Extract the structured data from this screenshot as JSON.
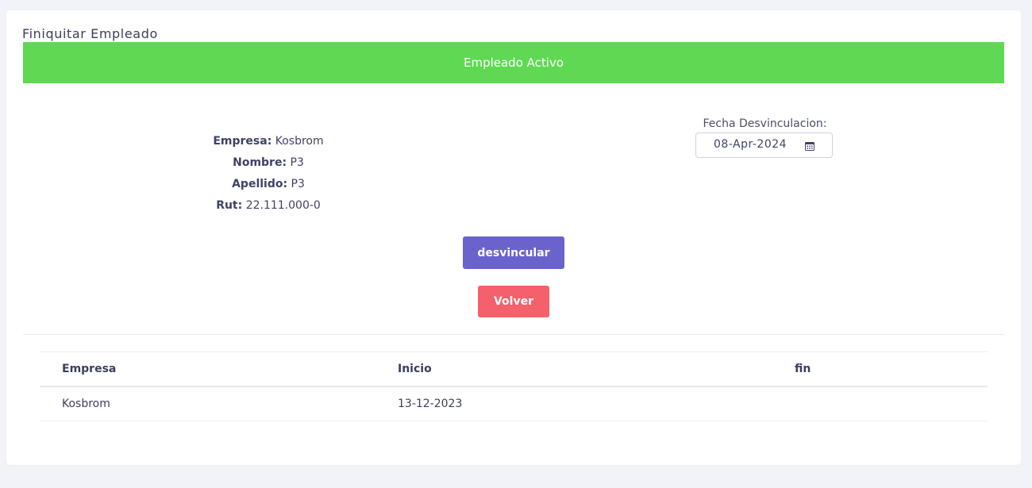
{
  "page": {
    "title": "Finiquitar Empleado",
    "status_banner": "Empleado Activo"
  },
  "employee": {
    "empresa_label": "Empresa:",
    "empresa": "Kosbrom",
    "nombre_label": "Nombre:",
    "nombre": "P3",
    "apellido_label": "Apellido:",
    "apellido": "P3",
    "rut_label": "Rut:",
    "rut": "22.111.000-0"
  },
  "date_field": {
    "label": "Fecha Desvinculacion:",
    "value": "08-Apr-2024",
    "icon": "calendar-icon"
  },
  "actions": {
    "desvincular": "desvincular",
    "volver": "Volver"
  },
  "table": {
    "headers": [
      "Empresa",
      "Inicio",
      "fin"
    ],
    "rows": [
      [
        "Kosbrom",
        "13-12-2023",
        ""
      ]
    ]
  },
  "colors": {
    "banner": "#5fd953",
    "primary": "#6b63cc",
    "danger": "#f4606b",
    "background": "#f2f3f8"
  }
}
